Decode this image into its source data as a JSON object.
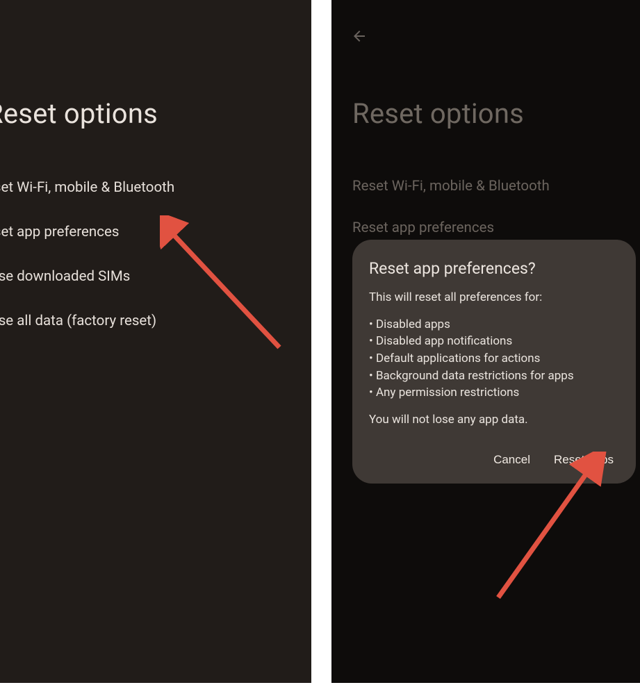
{
  "colors": {
    "arrow": "#e15241"
  },
  "left": {
    "title": "Reset options",
    "options": [
      "eset Wi-Fi, mobile & Bluetooth",
      "eset app preferences",
      "rase downloaded SIMs",
      "rase all data (factory reset)"
    ]
  },
  "right": {
    "title": "Reset options",
    "options": [
      "Reset Wi-Fi, mobile & Bluetooth",
      "Reset app preferences"
    ],
    "dialog": {
      "title": "Reset app preferences?",
      "intro": "This will reset all preferences for:",
      "bullets": [
        "Disabled apps",
        "Disabled app notifications",
        "Default applications for actions",
        "Background data restrictions for apps",
        "Any permission restrictions"
      ],
      "footer": "You will not lose any app data.",
      "cancel": "Cancel",
      "confirm": "Reset apps"
    }
  }
}
